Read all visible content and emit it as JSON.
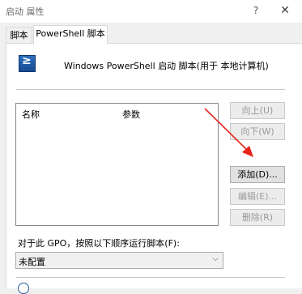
{
  "window": {
    "title": "启动 属性",
    "help_glyph": "?",
    "close_glyph": "✕"
  },
  "tabs": [
    {
      "label": "脚本",
      "active": false
    },
    {
      "label": "PowerShell 脚本",
      "active": true
    }
  ],
  "header": {
    "icon": "powershell-icon",
    "icon_glyph": "≥",
    "text": "Windows PowerShell 启动 脚本(用于 本地计算机)"
  },
  "script_list": {
    "columns": [
      "名称",
      "参数"
    ],
    "rows": []
  },
  "buttons": {
    "move_up": {
      "label": "向上(U)",
      "enabled": false
    },
    "move_down": {
      "label": "向下(W)",
      "enabled": false
    },
    "add": {
      "label": "添加(D)...",
      "enabled": true
    },
    "edit": {
      "label": "编辑(E)...",
      "enabled": false
    },
    "remove": {
      "label": "删除(R)",
      "enabled": false
    }
  },
  "order": {
    "label": "对于此 GPO，按照以下顺序运行脚本(F):",
    "selected": "未配置",
    "chevron_glyph": "⌵"
  },
  "colors": {
    "annotation_arrow": "#e8231b",
    "disabled_text": "#9a9a9a"
  }
}
